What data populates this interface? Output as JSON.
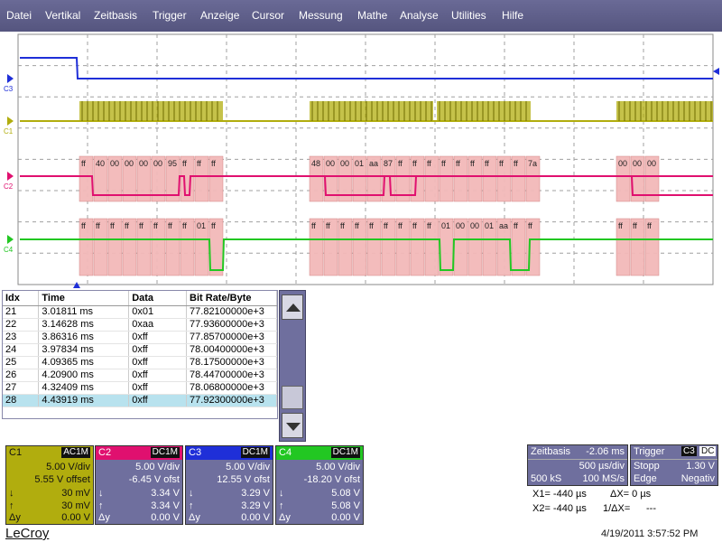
{
  "menu": [
    "Datei",
    "Vertikal",
    "Zeitbasis",
    "Trigger",
    "Anzeige",
    "Cursor",
    "Messung",
    "Mathe",
    "Analyse",
    "Utilities",
    "Hilfe"
  ],
  "traces": {
    "c3": {
      "label": "C3",
      "color": "#1f2fd8"
    },
    "c1": {
      "label": "C1",
      "color": "#b1ad0e"
    },
    "c2": {
      "label": "C2",
      "color": "#e0106f",
      "bytes": [
        "ff",
        "40",
        "00",
        "00",
        "00",
        "00",
        "95",
        "ff",
        "ff",
        "ff",
        "48",
        "00",
        "00",
        "01",
        "aa",
        "87",
        "ff",
        "ff",
        "ff",
        "ff",
        "ff",
        "ff",
        "ff",
        "ff",
        "ff",
        "7a",
        "00",
        "00",
        "00"
      ]
    },
    "c4": {
      "label": "C4",
      "color": "#22c722",
      "bytes": [
        "ff",
        "ff",
        "ff",
        "ff",
        "ff",
        "ff",
        "ff",
        "ff",
        "01",
        "ff",
        "ff",
        "ff",
        "ff",
        "ff",
        "ff",
        "ff",
        "ff",
        "ff",
        "ff",
        "01",
        "00",
        "00",
        "01",
        "aa",
        "ff",
        "ff",
        "ff",
        "ff",
        "ff"
      ]
    }
  },
  "table": {
    "headers": [
      "Idx",
      "Time",
      "Data",
      "Bit Rate/Byte"
    ],
    "rows": [
      [
        "21",
        "3.01811 ms",
        "0x01",
        "77.82100000e+3"
      ],
      [
        "22",
        "3.14628 ms",
        "0xaa",
        "77.93600000e+3"
      ],
      [
        "23",
        "3.86316 ms",
        "0xff",
        "77.85700000e+3"
      ],
      [
        "24",
        "3.97834 ms",
        "0xff",
        "78.00400000e+3"
      ],
      [
        "25",
        "4.09365 ms",
        "0xff",
        "78.17500000e+3"
      ],
      [
        "26",
        "4.20900 ms",
        "0xff",
        "78.44700000e+3"
      ],
      [
        "27",
        "4.32409 ms",
        "0xff",
        "78.06800000e+3"
      ],
      [
        "28",
        "4.43919 ms",
        "0xff",
        "77.92300000e+3"
      ]
    ],
    "selected_index": 7
  },
  "channels": [
    {
      "name": "C1",
      "coupling": "AC1M",
      "header_bg": "#b1ad0e",
      "body_bg": "#b1ad0e",
      "text": "#111111",
      "vdiv": "5.00 V/div",
      "offset": "5.55 V offset",
      "down": "30 mV",
      "up": "30 mV",
      "dy": "0.00 V"
    },
    {
      "name": "C2",
      "coupling": "DC1M",
      "header_bg": "#e0106f",
      "body_bg": "#6f6f9e",
      "text": "#ffffff",
      "vdiv": "5.00 V/div",
      "offset": "-6.45 V ofst",
      "down": "3.34 V",
      "up": "3.34 V",
      "dy": "0.00 V"
    },
    {
      "name": "C3",
      "coupling": "DC1M",
      "header_bg": "#1f2fd8",
      "body_bg": "#6f6f9e",
      "text": "#ffffff",
      "vdiv": "5.00 V/div",
      "offset": "12.55 V ofst",
      "down": "3.29 V",
      "up": "3.29 V",
      "dy": "0.00 V"
    },
    {
      "name": "C4",
      "coupling": "DC1M",
      "header_bg": "#22c722",
      "body_bg": "#6f6f9e",
      "text": "#ffffff",
      "vdiv": "5.00 V/div",
      "offset": "-18.20 V ofst",
      "down": "5.08 V",
      "up": "5.08 V",
      "dy": "0.00 V"
    }
  ],
  "symbols": {
    "down": "↓",
    "up": "↑",
    "dy": "Δy"
  },
  "timebase": {
    "label": "Zeitbasis",
    "delay": "-2.06 ms",
    "per_div": "500 µs/div",
    "samples": "500 kS",
    "rate": "100 MS/s"
  },
  "trigger": {
    "label": "Trigger",
    "source": "C3",
    "coupling": "DC",
    "mode": "Stopp",
    "level": "1.30 V",
    "type": "Edge",
    "slope": "Negativ"
  },
  "cursors": {
    "x1": "X1=  -440 µs",
    "dx": "ΔX=  0 µs",
    "x2": "X2=  -440 µs",
    "inv_dx": "1/ΔX=",
    "inv_dx_val": "---"
  },
  "brand": "LeCroy",
  "timestamp": "4/19/2011 3:57:52 PM"
}
